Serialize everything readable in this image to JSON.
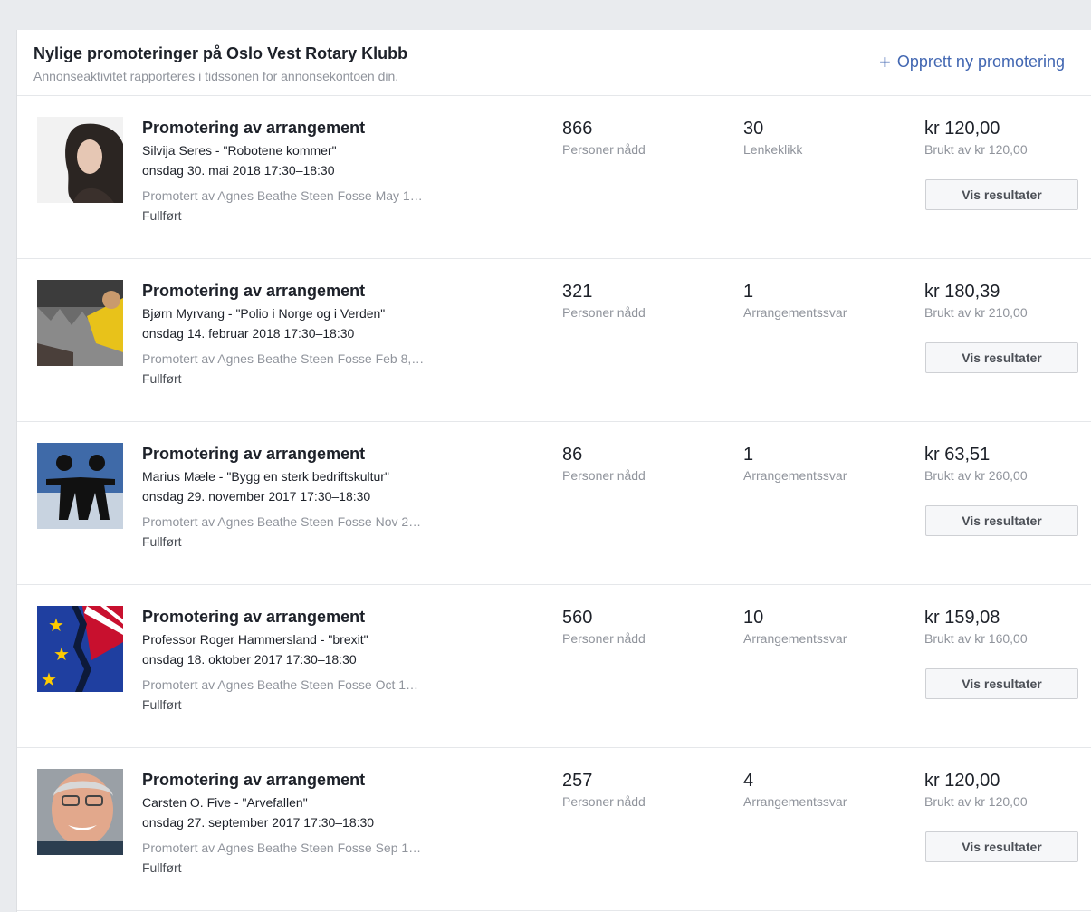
{
  "header": {
    "title": "Nylige promoteringer på Oslo Vest Rotary Klubb",
    "subtitle": "Annonseaktivitet rapporteres i tidssonen for annonsekontoen din.",
    "create_label": "Opprett ny promotering",
    "create_icon": "plus-icon"
  },
  "accent_color": "#4267b2",
  "promotions": [
    {
      "title": "Promotering av arrangement",
      "event": "Silvija Seres - \"Robotene kommer\"",
      "date": "onsdag 30. mai 2018 17:30–18:30",
      "promoted_by": "Promotert av Agnes Beathe Steen Fosse May 1…",
      "status": "Fullført",
      "reach_value": "866",
      "reach_label": "Personer nådd",
      "result_value": "30",
      "result_label": "Lenkeklikk",
      "spent_value": "kr 120,00",
      "spent_label": "Brukt av kr 120,00",
      "button_label": "Vis resultater"
    },
    {
      "title": "Promotering av arrangement",
      "event": "Bjørn Myrvang - \"Polio i Norge og i Verden\"",
      "date": "onsdag 14. februar 2018 17:30–18:30",
      "promoted_by": "Promotert av Agnes Beathe Steen Fosse Feb 8,…",
      "status": "Fullført",
      "reach_value": "321",
      "reach_label": "Personer nådd",
      "result_value": "1",
      "result_label": "Arrangementssvar",
      "spent_value": "kr 180,39",
      "spent_label": "Brukt av kr 210,00",
      "button_label": "Vis resultater"
    },
    {
      "title": "Promotering av arrangement",
      "event": "Marius Mæle - \"Bygg en sterk bedriftskultur\"",
      "date": "onsdag 29. november 2017 17:30–18:30",
      "promoted_by": "Promotert av Agnes Beathe Steen Fosse Nov 2…",
      "status": "Fullført",
      "reach_value": "86",
      "reach_label": "Personer nådd",
      "result_value": "1",
      "result_label": "Arrangementssvar",
      "spent_value": "kr 63,51",
      "spent_label": "Brukt av kr 260,00",
      "button_label": "Vis resultater"
    },
    {
      "title": "Promotering av arrangement",
      "event": "Professor Roger Hammersland - \"brexit\"",
      "date": "onsdag 18. oktober 2017 17:30–18:30",
      "promoted_by": "Promotert av Agnes Beathe Steen Fosse Oct 1…",
      "status": "Fullført",
      "reach_value": "560",
      "reach_label": "Personer nådd",
      "result_value": "10",
      "result_label": "Arrangementssvar",
      "spent_value": "kr 159,08",
      "spent_label": "Brukt av kr 160,00",
      "button_label": "Vis resultater"
    },
    {
      "title": "Promotering av arrangement",
      "event": "Carsten O. Five - \"Arvefallen\"",
      "date": "onsdag 27. september 2017 17:30–18:30",
      "promoted_by": "Promotert av Agnes Beathe Steen Fosse Sep 1…",
      "status": "Fullført",
      "reach_value": "257",
      "reach_label": "Personer nådd",
      "result_value": "4",
      "result_label": "Arrangementssvar",
      "spent_value": "kr 120,00",
      "spent_label": "Brukt av kr 120,00",
      "button_label": "Vis resultater"
    }
  ]
}
